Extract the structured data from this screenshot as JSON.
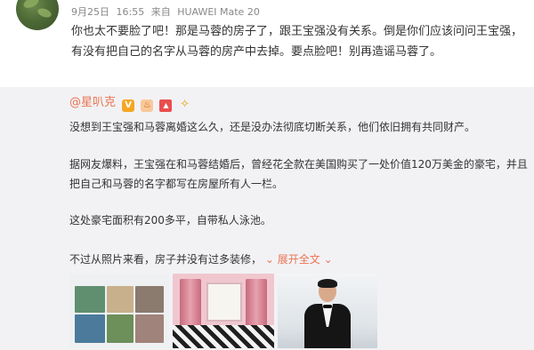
{
  "comment": {
    "meta": {
      "date": "9月25日",
      "time": "16:55",
      "source_prefix": "来自",
      "device": "HUAWEI Mate 20"
    },
    "text": "你也太不要脸了吧！那是马蓉的房子了，跟王宝强没有关系。倒是你们应该问问王宝强，有没有把自己的名字从马蓉的房产中去掉。要点脸吧！别再造谣马蓉了。"
  },
  "repost": {
    "author": "@星叭克",
    "paragraphs": [
      "没想到王宝强和马蓉离婚这么久，还是没办法彻底切断关系，他们依旧拥有共同财产。",
      "据网友爆料，王宝强在和马蓉结婚后，曾经花全款在美国购买了一处价值120万美金的豪宅，并且把自己和马蓉的名字都写在房屋所有人一栏。",
      "这处豪宅面积有200多平，自带私人泳池。",
      "不过从照片来看，房子并没有过多装修，"
    ],
    "expand_label": "展开全文",
    "expand_icon": "chevron-down-icon",
    "badges": [
      "verified-v-icon",
      "fire-icon",
      "vip-icon",
      "bulb-icon"
    ]
  },
  "colors": {
    "link": "#eb7350",
    "repost_bg": "#f2f2f5",
    "text": "#333333",
    "meta": "#888888"
  }
}
